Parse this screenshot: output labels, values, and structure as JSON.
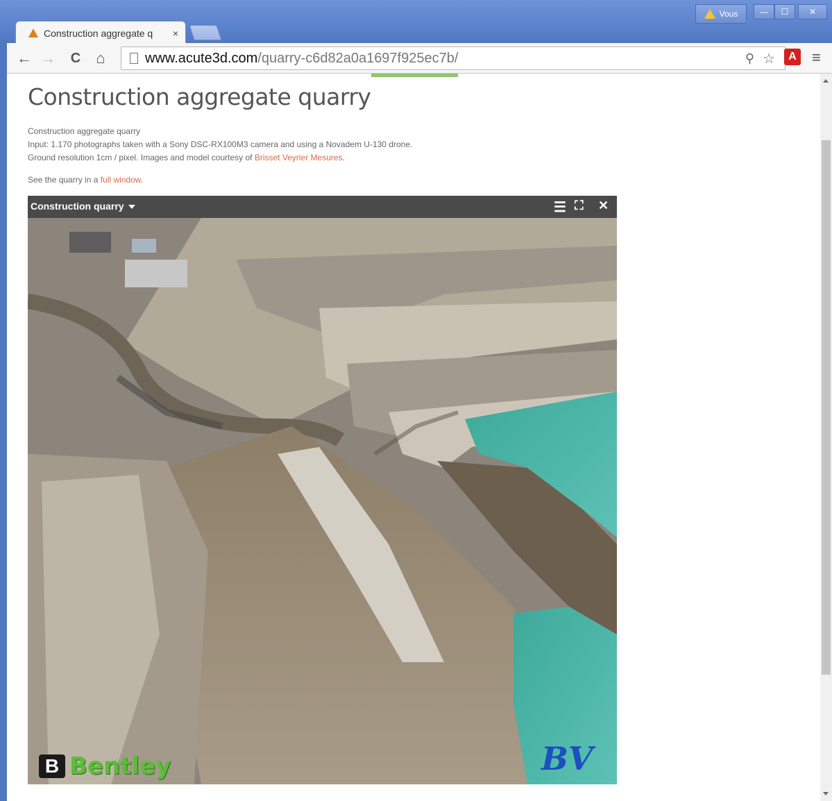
{
  "window": {
    "user_label": "Vous",
    "minimize_label": "—",
    "maximize_label": "☐",
    "close_label": "✕"
  },
  "tab": {
    "title": "Construction aggregate q",
    "close": "×"
  },
  "toolbar": {
    "back": "←",
    "forward": "→",
    "reload": "C",
    "home": "⌂",
    "url_host": "www.acute3d.com",
    "url_path": "/quarry-c6d82a0a1697f925ec7b/",
    "zoom_icon": "⚲",
    "star_icon": "☆",
    "extension_icon": "A",
    "menu_icon": "≡"
  },
  "page": {
    "title": "Construction aggregate quarry",
    "desc_line1": "Construction aggregate quarry",
    "desc_line2": "Input: 1.170 photographs taken with a Sony DSC-RX100M3 camera and using a Novadem U-130 drone.",
    "desc_line3_prefix": "Ground resolution 1cm / pixel. Images and model courtesy of ",
    "desc_line3_link": "Brisset Veyrier Mesures",
    "desc_line3_suffix": ".",
    "see_prefix": "See the quarry in a ",
    "see_link": "full window",
    "see_suffix": "."
  },
  "viewer": {
    "title": "Construction quarry",
    "menu_icon": "☰",
    "fullscreen_icon": "⛶",
    "close_icon": "✕",
    "logo_bentley_mark": "B",
    "logo_bentley_text": "Bentley",
    "logo_bv_text": "BV"
  },
  "colors": {
    "chrome_blue": "#5b82cc",
    "link": "#d9694a",
    "water": "#3fb2a4"
  }
}
